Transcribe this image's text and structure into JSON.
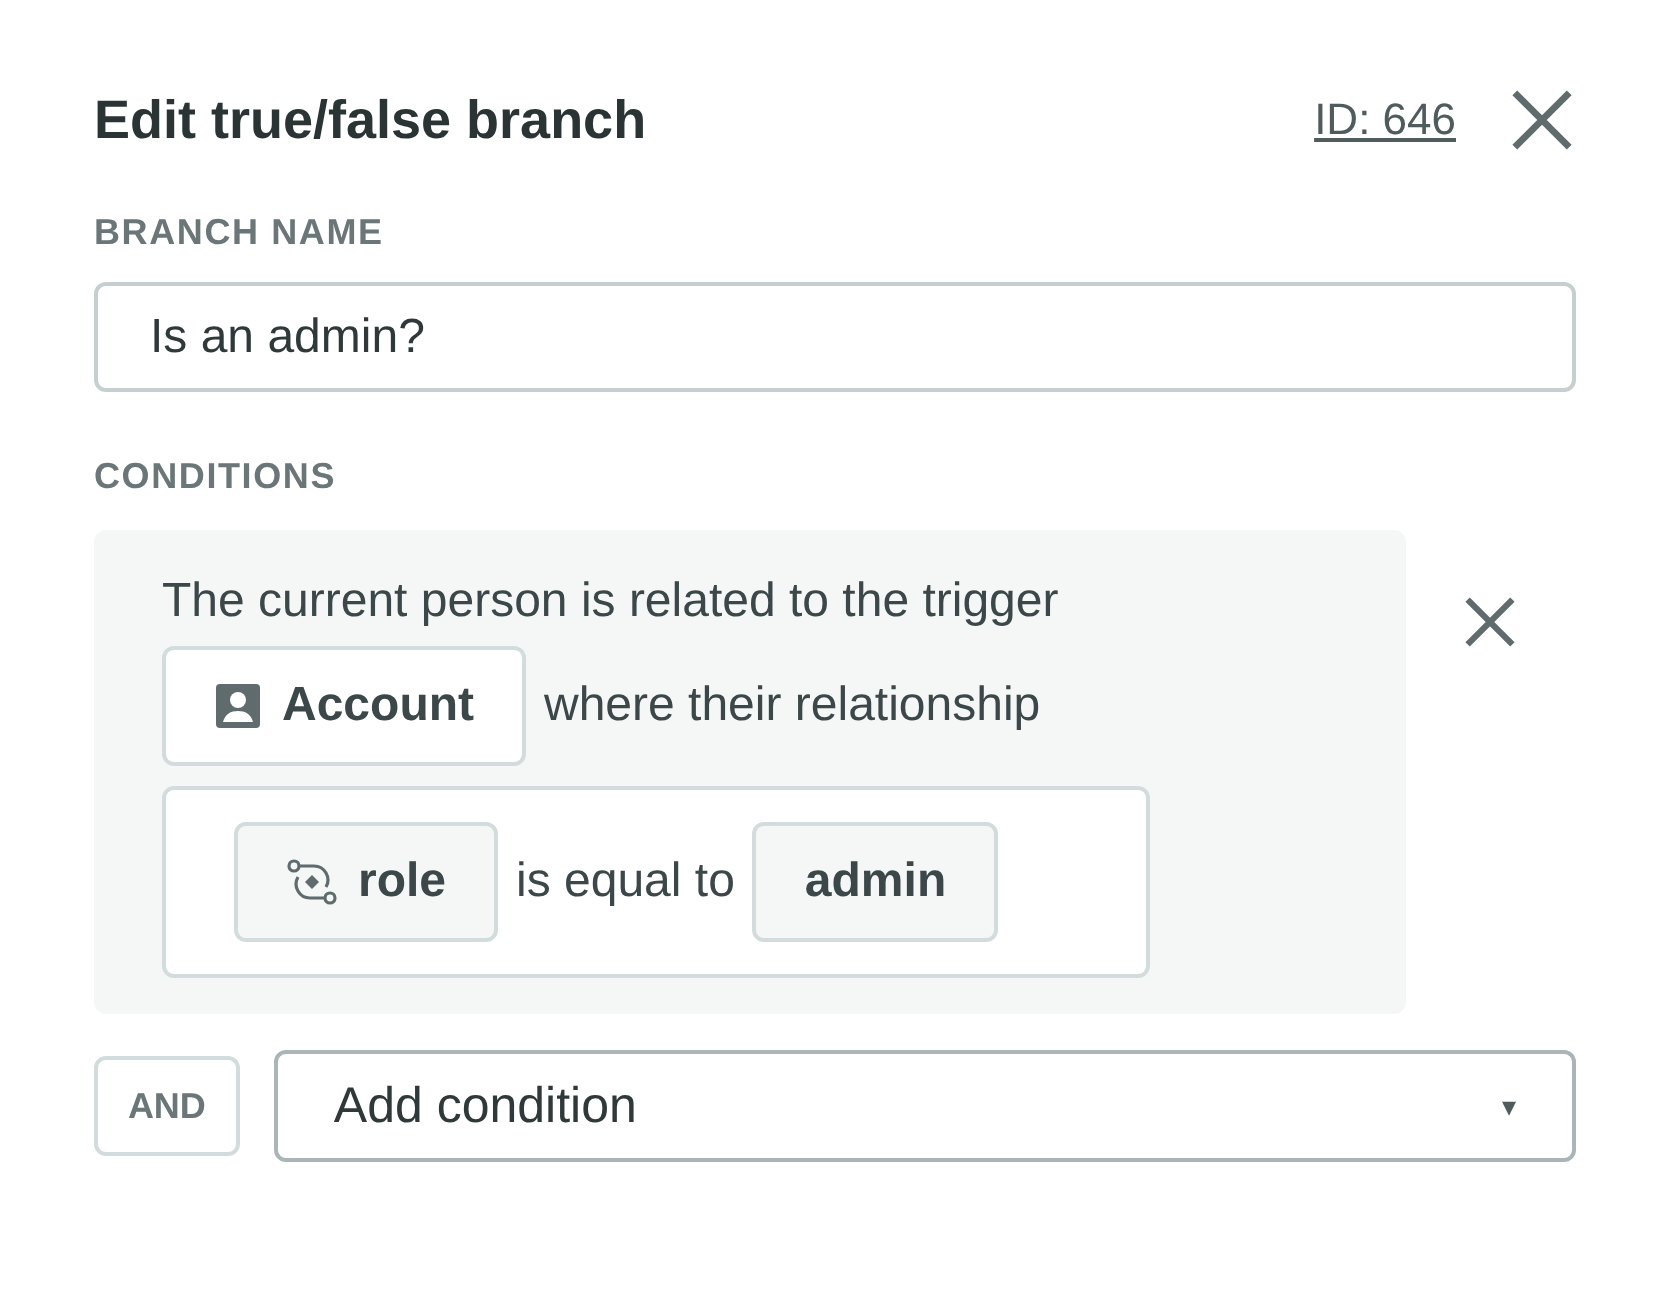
{
  "panel": {
    "title": "Edit true/false branch",
    "id_link": "ID: 646"
  },
  "branch_name": {
    "label": "BRANCH NAME",
    "value": "Is an admin?"
  },
  "conditions": {
    "label": "CONDITIONS",
    "items": [
      {
        "intro": "The current person is related to the trigger",
        "object": "Account",
        "relation_text": "where their relationship",
        "attribute": "role",
        "operator": "is equal to",
        "value": "admin"
      }
    ]
  },
  "add_row": {
    "joiner": "AND",
    "placeholder": "Add condition",
    "caret": "▾"
  }
}
